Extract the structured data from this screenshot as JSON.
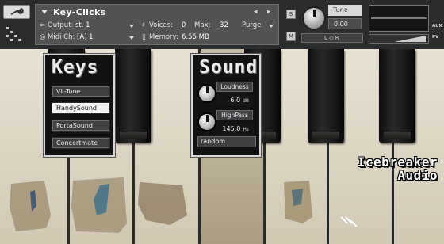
{
  "header": {
    "title": "Key-Clicks",
    "nav_prev": "◂",
    "nav_next": "▸",
    "output_label": "Output:",
    "output_value": "st. 1",
    "voices_label": "Voices:",
    "voices_value": "0",
    "max_label": "Max:",
    "max_value": "32",
    "purge_label": "Purge",
    "midi_label": "Midi Ch:",
    "midi_value": "[A] 1",
    "memory_label": "Memory:",
    "memory_value": "6.55 MB",
    "solo_label": "S",
    "mute_label": "M",
    "tune_label": "Tune",
    "tune_value": "0.00",
    "pan_label": "L ◇ R",
    "aux_label": "AUX",
    "pv_label": "PV"
  },
  "keys_panel": {
    "title": "Keys",
    "options": [
      "VL-Tone",
      "HandySound",
      "PortaSound",
      "Concertmate"
    ],
    "selected": "HandySound"
  },
  "sound_panel": {
    "title": "Sound",
    "loudness": {
      "label": "Loudness",
      "value": "6.0",
      "unit": "dB"
    },
    "highpass": {
      "label": "HighPass",
      "value": "145.0",
      "unit": "Hz"
    },
    "random_value": "random"
  },
  "brand": {
    "line1": "Icebreaker",
    "line2": "Audio"
  },
  "colors": {
    "header_bg": "#2b2c2d",
    "panel_bg": "#121212",
    "key_ivory": "#ddd7c6",
    "black_key": "#151515",
    "button_active": "#f2f2f2"
  }
}
